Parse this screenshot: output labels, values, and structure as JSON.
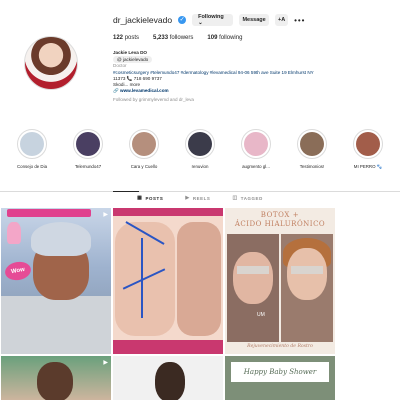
{
  "profile": {
    "username": "dr_jackielevado",
    "following_label": "Following ⌄",
    "message_label": "Message",
    "add_user_label": "+A",
    "more_label": "•••",
    "stats": [
      {
        "value": "122",
        "label": "posts"
      },
      {
        "value": "5,233",
        "label": "followers"
      },
      {
        "value": "109",
        "label": "following"
      }
    ]
  },
  "bio": {
    "name": "Jackie Leva DO",
    "threads_handle": "@ jackielevado",
    "category": "Doctor",
    "hashtags": "#cosmeticsurgery #telemundo47 #dermatology #levamedical 94-06 59th ave Suite 19 Elmhurst NY",
    "address_phone": "11373 📞 718 690 9737",
    "more": "Skodi... more",
    "link": "🔗 www.levamedical.com",
    "followed_by": "Followed by grimmylevemd and dr_leva"
  },
  "highlights": [
    {
      "label": "Consejo de Dia",
      "color": "#c7d3df"
    },
    {
      "label": "Telemundo47",
      "color": "#4a3f62"
    },
    {
      "label": "Cara y Cuello",
      "color": "#b58f7d"
    },
    {
      "label": "renuvion",
      "color": "#3b3b4a"
    },
    {
      "label": "augmento gl...",
      "color": "#e8b7c8"
    },
    {
      "label": "Testimonios!",
      "color": "#8a6d58"
    },
    {
      "label": "MI PERRO 🐾",
      "color": "#a25d4a"
    }
  ],
  "tabs": [
    {
      "label": "POSTS",
      "icon": "grid-icon",
      "glyph": "▦"
    },
    {
      "label": "REELS",
      "icon": "reels-icon",
      "glyph": "▶"
    },
    {
      "label": "TAGGED",
      "icon": "tagged-icon",
      "glyph": "◫"
    }
  ],
  "posts": {
    "p1_badge": "Wow",
    "p3_title1": "BOTOX +",
    "p3_title2": "ÁCIDO HIALURÓNICO",
    "p3_um": "UM",
    "p3_caption": "Rejuvenecimiento de Rostro",
    "p6_card": "Happy Baby Shower",
    "reel_glyph": "▶"
  }
}
